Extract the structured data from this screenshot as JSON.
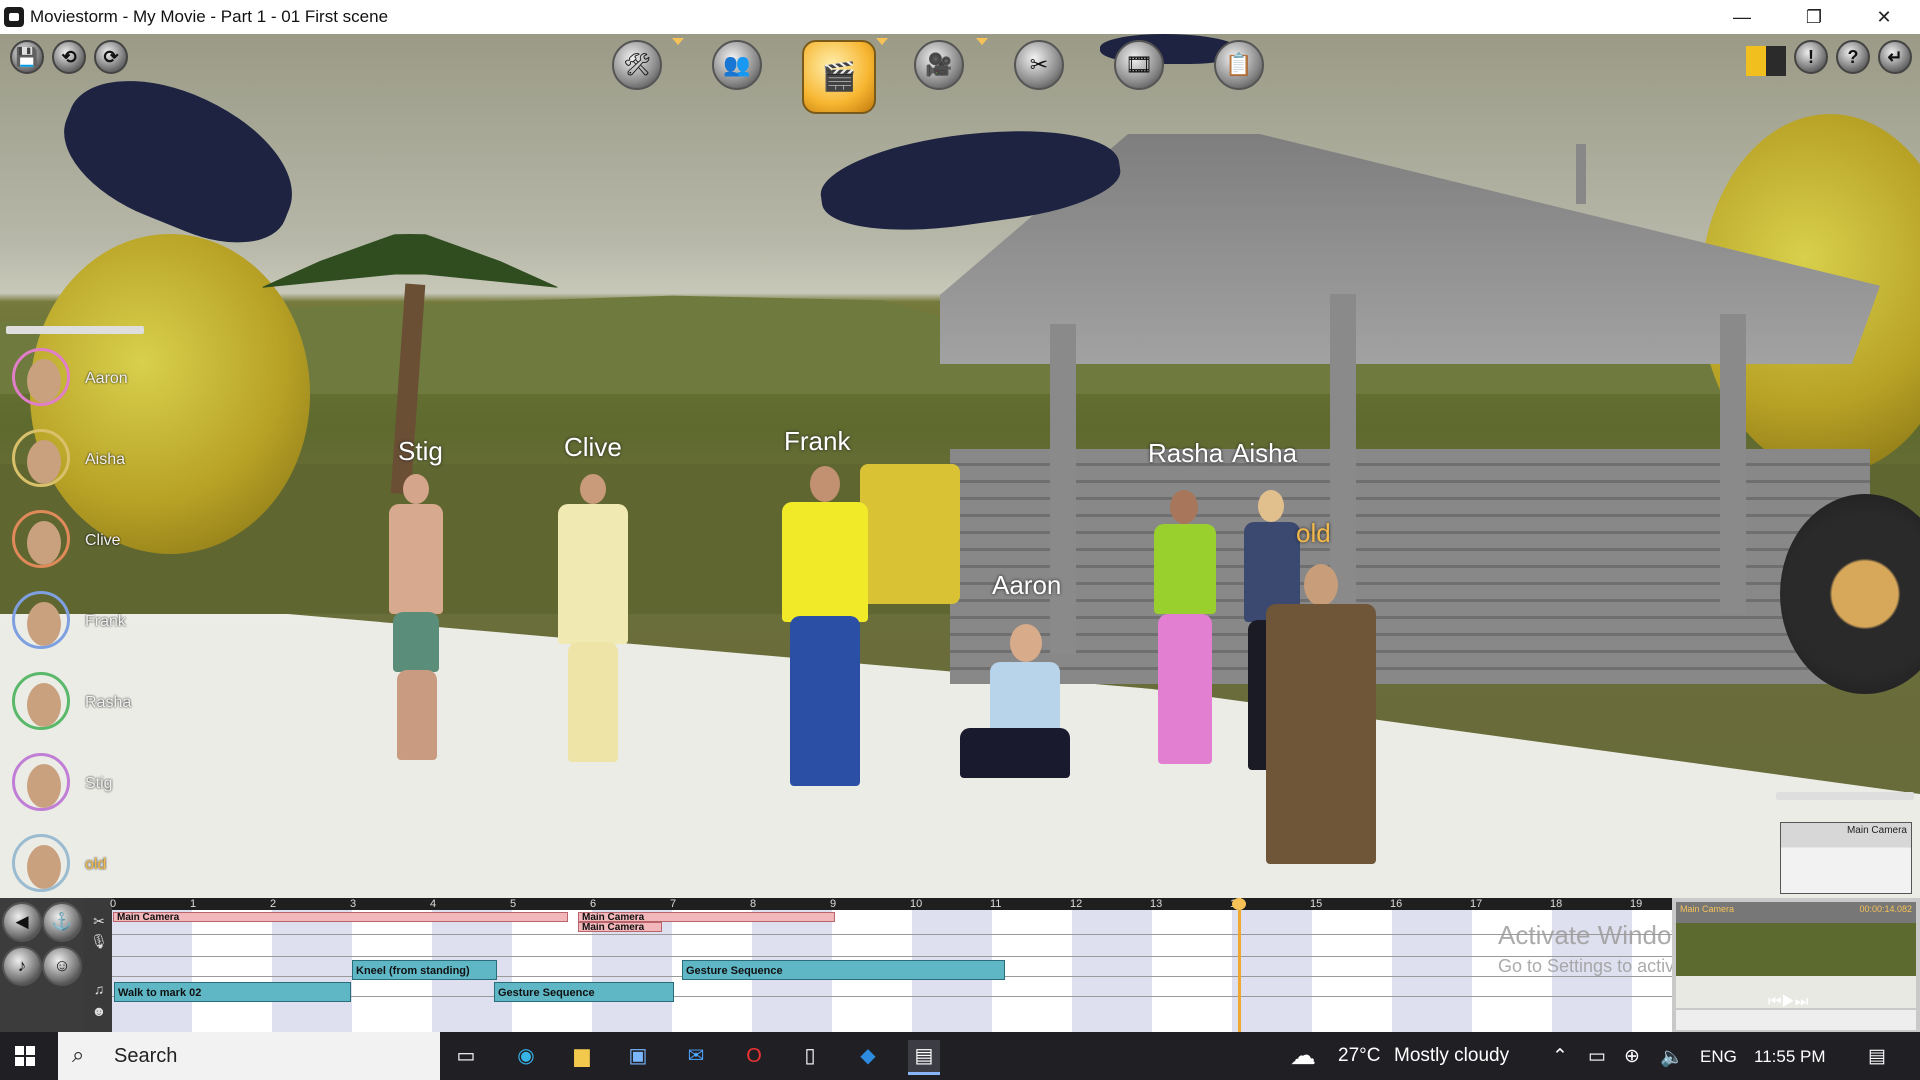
{
  "window": {
    "title": "Moviestorm - My Movie - Part 1 - 01 First scene",
    "minimize": "—",
    "restore": "❐",
    "close": "✕"
  },
  "toolbar": {
    "left_buttons": [
      {
        "icon": "save-icon",
        "glyph": "💾"
      },
      {
        "icon": "undo-icon",
        "glyph": "⟲"
      },
      {
        "icon": "redo-icon",
        "glyph": "⟳"
      }
    ],
    "modes": [
      {
        "name": "set-tools",
        "glyph": "🛠"
      },
      {
        "name": "cast",
        "glyph": "👥"
      },
      {
        "name": "scene-director",
        "glyph": "🎬",
        "active": true
      },
      {
        "name": "camera",
        "glyph": "🎥"
      },
      {
        "name": "edit-cut",
        "glyph": "✂"
      },
      {
        "name": "movie-reel",
        "glyph": "🎞"
      },
      {
        "name": "script",
        "glyph": "📋"
      }
    ],
    "right_buttons": [
      {
        "icon": "alert-icon",
        "glyph": "!"
      },
      {
        "icon": "help-icon",
        "glyph": "?"
      },
      {
        "icon": "return-icon",
        "glyph": "↵"
      }
    ]
  },
  "cast": [
    {
      "name": "Aaron",
      "ring": "#e07ec9",
      "highlight": false
    },
    {
      "name": "Aisha",
      "ring": "#d9c06a",
      "highlight": false
    },
    {
      "name": "Clive",
      "ring": "#e08a5a",
      "highlight": false
    },
    {
      "name": "Frank",
      "ring": "#7ea0e0",
      "highlight": false
    },
    {
      "name": "Rasha",
      "ring": "#5ab86a",
      "highlight": false
    },
    {
      "name": "Stig",
      "ring": "#c07ed6",
      "highlight": false
    },
    {
      "name": "old",
      "ring": "#9abbd0",
      "highlight": true
    }
  ],
  "scene_labels": {
    "stig": "Stig",
    "clive": "Clive",
    "frank": "Frank",
    "aaron": "Aaron",
    "rasha": "Rasha",
    "aisha": "Aisha",
    "old": "old"
  },
  "viewport_panel": {
    "label": "Main Camera"
  },
  "timeline": {
    "ticks": [
      "0",
      "1",
      "2",
      "3",
      "4",
      "5",
      "6",
      "7",
      "8",
      "9",
      "10",
      "11",
      "12",
      "13",
      "14",
      "15",
      "16",
      "17",
      "18",
      "19"
    ],
    "camera_clips": [
      {
        "label": "Main Camera"
      },
      {
        "label": "Main Camera"
      },
      {
        "label": "Main Camera"
      }
    ],
    "action_clips": [
      {
        "label": "Kneel (from standing)"
      },
      {
        "label": "Gesture Sequence"
      },
      {
        "label": "Walk to mark 02"
      },
      {
        "label": "Gesture Sequence"
      }
    ],
    "playhead_marker": "14",
    "watermark_title": "Activate Windows",
    "watermark_sub": "Go to Settings to activate Windows.",
    "minimap_label": "Main Camera",
    "minimap_time": "00:00:14.082"
  },
  "taskbar": {
    "search_placeholder": "Search",
    "weather_temp": "27°C",
    "weather_desc": "Mostly cloudy",
    "language": "ENG",
    "time": "11:55 PM"
  },
  "colors": {
    "accent_active": "#f7b631",
    "playhead": "#f0a830",
    "old_label": "#f2b94a"
  }
}
